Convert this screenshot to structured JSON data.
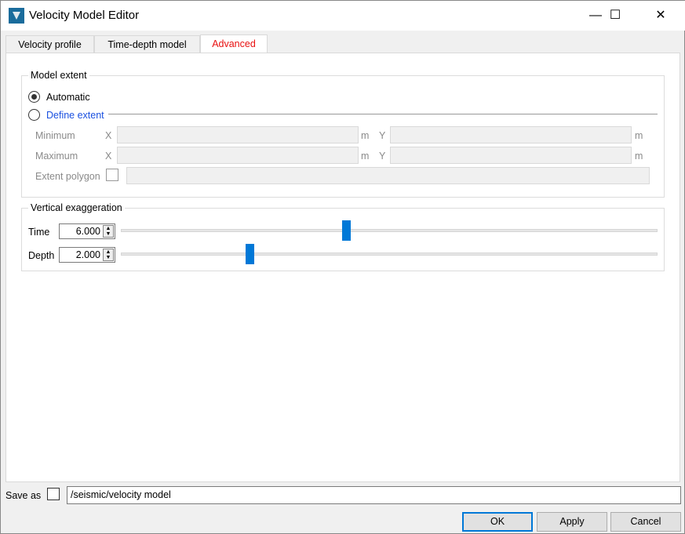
{
  "window": {
    "title": "Velocity Model Editor",
    "minimize": "—",
    "maximize": "☐",
    "close": "✕"
  },
  "tabs": [
    {
      "label": "Velocity profile"
    },
    {
      "label": "Time-depth model"
    },
    {
      "label": "Advanced",
      "active": true
    }
  ],
  "model_extent": {
    "title": "Model extent",
    "automatic": "Automatic",
    "define": "Define extent",
    "selected": "Automatic",
    "minimum": "Minimum",
    "maximum": "Maximum",
    "x": "X",
    "y": "Y",
    "unit": "m",
    "polygon": "Extent polygon"
  },
  "vertical_exaggeration": {
    "title": "Vertical exaggeration",
    "time": {
      "label": "Time",
      "value": "6.000",
      "slider_fraction": 0.42
    },
    "depth": {
      "label": "Depth",
      "value": "2.000",
      "slider_fraction": 0.24
    }
  },
  "save": {
    "label": "Save as",
    "path": "/seismic/velocity model"
  },
  "buttons": {
    "ok": "OK",
    "apply": "Apply",
    "cancel": "Cancel"
  },
  "colors": {
    "accent": "#0078d7",
    "active_tab": "#e81010",
    "link": "#1a50e0"
  }
}
